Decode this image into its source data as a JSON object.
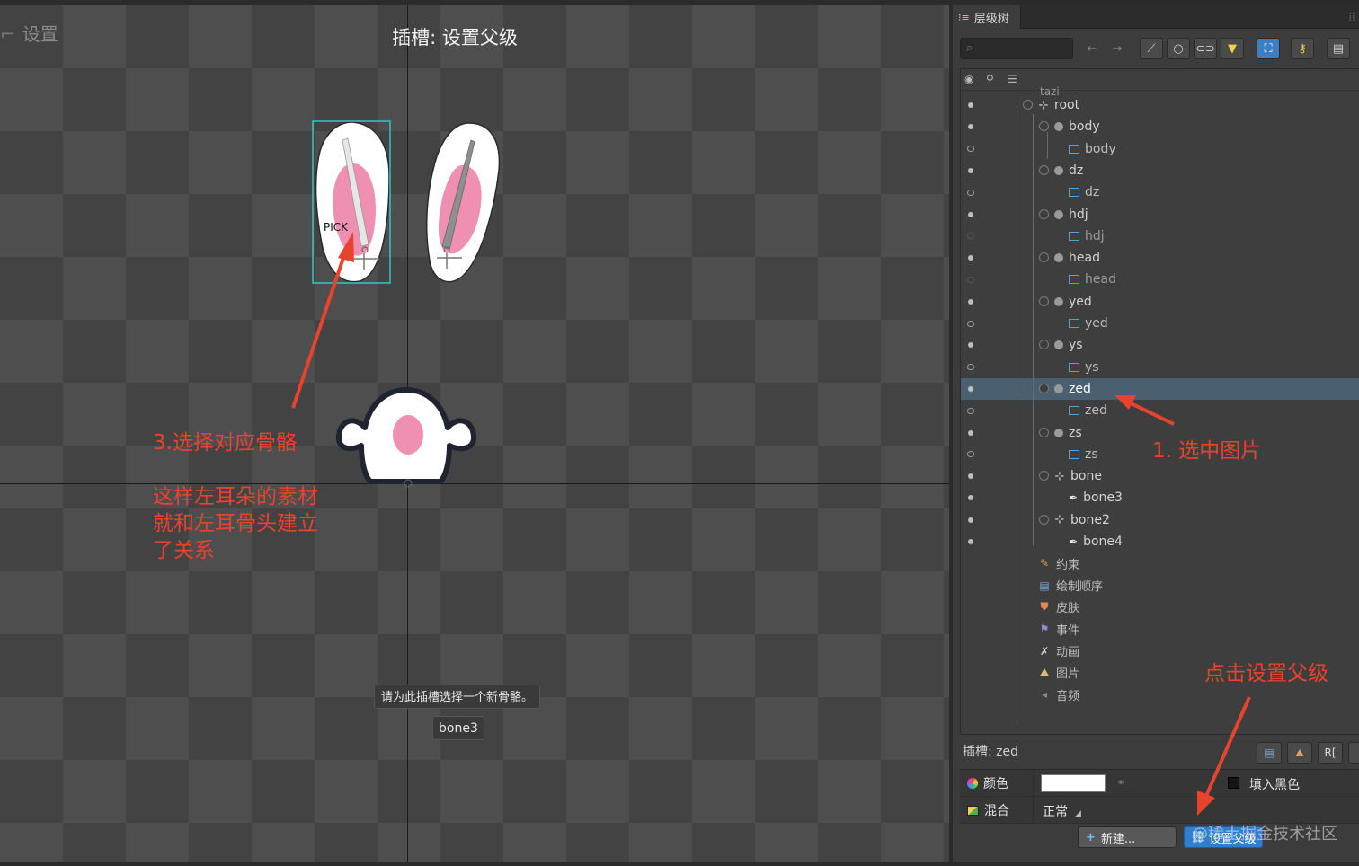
{
  "viewport": {
    "settings_tick": "⌐",
    "settings_label": "设置",
    "title": "插槽: 设置父级",
    "pick_label": "PICK",
    "annotation_step3": "3.选择对应骨骼",
    "annotation_result_line1": "这样左耳朵的素材",
    "annotation_result_line2": "就和左耳骨头建立",
    "annotation_result_line3": "了关系",
    "prompt": "请为此插槽选择一个新骨骼。",
    "bone_chip": "bone3"
  },
  "panel": {
    "tab_label": "层级树",
    "search_icon": "search-icon",
    "tree_cut_label": "tazi",
    "rows": [
      {
        "label": "root",
        "type": "bone",
        "eye": "dot"
      },
      {
        "label": "body",
        "type": "slot",
        "eye": "dot"
      },
      {
        "label": "body",
        "type": "attachment",
        "eye": "link"
      },
      {
        "label": "dz",
        "type": "slot",
        "eye": "dot"
      },
      {
        "label": "dz",
        "type": "attachment",
        "eye": "link"
      },
      {
        "label": "hdj",
        "type": "slot",
        "eye": "dot"
      },
      {
        "label": "hdj",
        "type": "attachment",
        "eye": "faint"
      },
      {
        "label": "head",
        "type": "slot",
        "eye": "dot"
      },
      {
        "label": "head",
        "type": "attachment",
        "eye": "faint"
      },
      {
        "label": "yed",
        "type": "slot",
        "eye": "dot"
      },
      {
        "label": "yed",
        "type": "attachment",
        "eye": "link"
      },
      {
        "label": "ys",
        "type": "slot",
        "eye": "dot"
      },
      {
        "label": "ys",
        "type": "attachment",
        "eye": "link"
      },
      {
        "label": "zed",
        "type": "slot",
        "eye": "dot",
        "selected": true
      },
      {
        "label": "zed",
        "type": "attachment",
        "eye": "link"
      },
      {
        "label": "zs",
        "type": "slot",
        "eye": "dot"
      },
      {
        "label": "zs",
        "type": "attachment",
        "eye": "link"
      },
      {
        "label": "bone",
        "type": "bone",
        "eye": "dot"
      },
      {
        "label": "bone3",
        "type": "bone-leaf",
        "eye": "dot"
      },
      {
        "label": "bone2",
        "type": "bone",
        "eye": "dot"
      },
      {
        "label": "bone4",
        "type": "bone-leaf",
        "eye": "dot"
      },
      {
        "label": "约束",
        "type": "section"
      },
      {
        "label": "绘制顺序",
        "type": "section"
      },
      {
        "label": "皮肤",
        "type": "section"
      },
      {
        "label": "事件",
        "type": "section"
      },
      {
        "label": "动画",
        "type": "section"
      },
      {
        "label": "图片",
        "type": "section"
      },
      {
        "label": "音频",
        "type": "section"
      }
    ],
    "annotation_select_image": "1. 选中图片",
    "annotation_click_parent": "点击设置父级",
    "slot_title": "插槽: zed",
    "slot_btn_ri": "R[",
    "color_label": "颜色",
    "fill_black_label": "填入黑色",
    "blend_label": "混合",
    "blend_value": "正常",
    "new_button": "新建...",
    "set_parent_button": "设置父级",
    "watermark": "@稀土掘金技术社区"
  },
  "colors": {
    "accent_blue": "#2f7fd0",
    "annotation_red": "#e8432e",
    "selection_teal": "#33c6c9",
    "ear_pink": "#ef8fb2"
  }
}
